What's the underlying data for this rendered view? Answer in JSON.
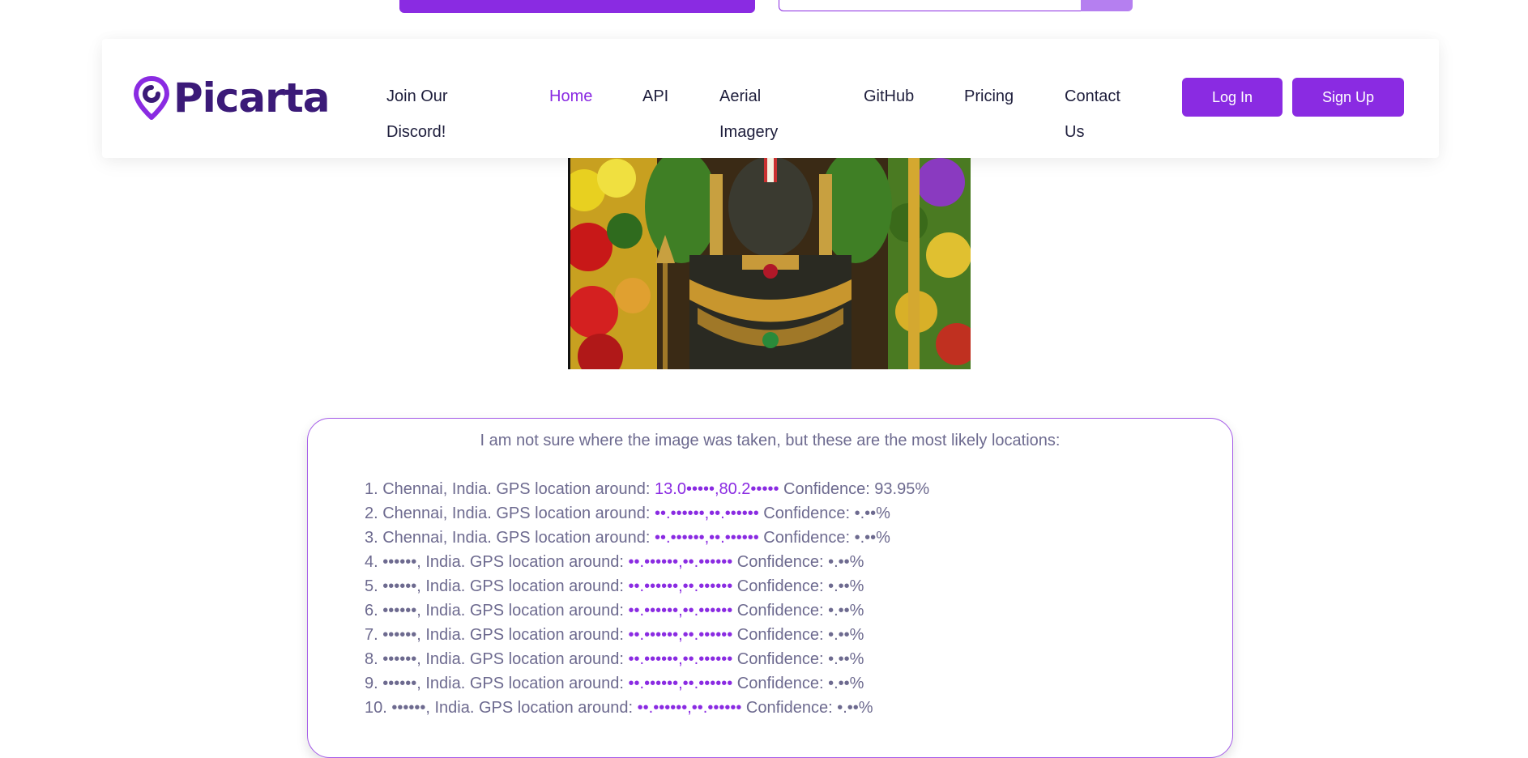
{
  "brand": {
    "name": "Picarta",
    "accent": "#8a2be2",
    "dark": "#3b1a78"
  },
  "nav": {
    "items": [
      {
        "label_line1": "Join Our",
        "label_line2": "Discord!"
      },
      {
        "label_line1": "Home",
        "label_line2": ""
      },
      {
        "label_line1": "API",
        "label_line2": ""
      },
      {
        "label_line1": "Aerial",
        "label_line2": "Imagery"
      },
      {
        "label_line1": "GitHub",
        "label_line2": ""
      },
      {
        "label_line1": "Pricing",
        "label_line2": ""
      },
      {
        "label_line1": "Contact",
        "label_line2": "Us"
      }
    ],
    "active": "Home",
    "login_label": "Log In",
    "signup_label": "Sign Up"
  },
  "photo": {
    "description_icon": "uploaded-photo"
  },
  "results": {
    "intro": "I am not sure where the image was taken, but these are the most likely locations:",
    "items": [
      {
        "prefix": "1. Chennai, India. GPS location around: ",
        "gps": "13.0•••••,80.2•••••",
        "confidence": " Confidence: 93.95%"
      },
      {
        "prefix": "2. Chennai, India. GPS location around: ",
        "gps": "••.••••••,••.••••••",
        "confidence": " Confidence: •.••%"
      },
      {
        "prefix": "3. Chennai, India. GPS location around: ",
        "gps": "••.••••••,••.••••••",
        "confidence": " Confidence: •.••%"
      },
      {
        "prefix": "4. ••••••, India. GPS location around: ",
        "gps": "••.••••••,••.••••••",
        "confidence": " Confidence: •.••%"
      },
      {
        "prefix": "5. ••••••, India. GPS location around: ",
        "gps": "••.••••••,••.••••••",
        "confidence": " Confidence: •.••%"
      },
      {
        "prefix": "6. ••••••, India. GPS location around: ",
        "gps": "••.••••••,••.••••••",
        "confidence": " Confidence: •.••%"
      },
      {
        "prefix": "7. ••••••, India. GPS location around: ",
        "gps": "••.••••••,••.••••••",
        "confidence": " Confidence: •.••%"
      },
      {
        "prefix": "8. ••••••, India. GPS location around: ",
        "gps": "••.••••••,••.••••••",
        "confidence": " Confidence: •.••%"
      },
      {
        "prefix": "9. ••••••, India. GPS location around: ",
        "gps": "••.••••••,••.••••••",
        "confidence": " Confidence: •.••%"
      },
      {
        "prefix": "10. ••••••, India. GPS location around: ",
        "gps": "••.••••••,••.••••••",
        "confidence": " Confidence: •.••%"
      }
    ]
  }
}
